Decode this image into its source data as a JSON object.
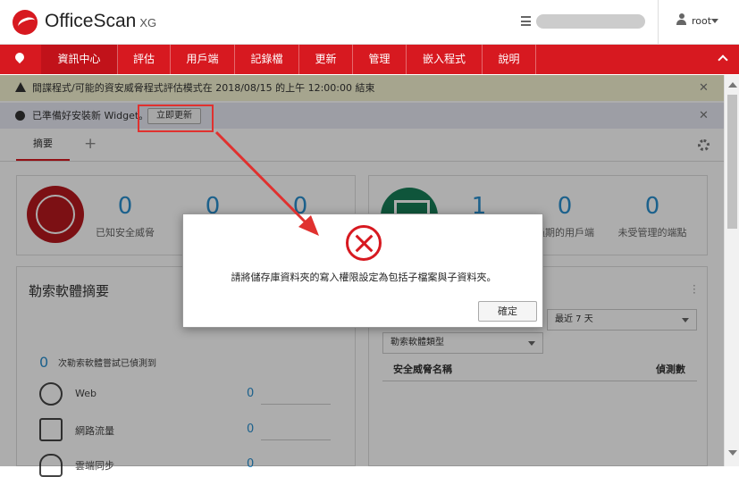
{
  "header": {
    "brand": "OfficeScan",
    "brand_suffix": "XG",
    "user": "root"
  },
  "nav": {
    "items": [
      "資訊中心",
      "評估",
      "用戶端",
      "記錄檔",
      "更新",
      "管理",
      "嵌入程式",
      "說明"
    ],
    "active_index": 0
  },
  "banners": {
    "eval_notice": "間諜程式/可能的資安威脅程式評估模式在 2018/08/15 的上午 12:00:00 結束",
    "widget_notice": "已準備好安裝新 Widget。",
    "update_now": "立即更新"
  },
  "tabs": {
    "summary": "摘要",
    "add": "+"
  },
  "left_card": {
    "stats": [
      {
        "value": "0",
        "label": "已知安全威脅"
      },
      {
        "value": "0",
        "label": ""
      },
      {
        "value": "0",
        "label": ""
      }
    ]
  },
  "right_card": {
    "stats": [
      {
        "value": "1",
        "label": ""
      },
      {
        "value": "0",
        "label": "過期的用戶端"
      },
      {
        "value": "0",
        "label": "未受管理的端點"
      }
    ]
  },
  "ransomware": {
    "title": "勒索軟體摘要",
    "count_value": "0",
    "count_label": "次勒索軟體嘗試已偵測到",
    "rows": [
      {
        "label": "Web",
        "value": "0",
        "icon": "globe-icon"
      },
      {
        "label": "網路流量",
        "value": "0",
        "icon": "network-icon"
      },
      {
        "label": "雲端同步",
        "value": "0",
        "icon": "cloud-icon"
      }
    ]
  },
  "threat_panel": {
    "period": "最近 7 天",
    "type_filter": "勒索軟體類型",
    "col_name": "安全威脅名稱",
    "col_count": "偵測數"
  },
  "dialog": {
    "message": "請將儲存庫資料夾的寫入權限設定為包括子檔案與子資料夾。",
    "ok": "確定"
  },
  "colors": {
    "brand_red": "#d71920",
    "accent_blue": "#2a8fcf",
    "callout_red": "#e0312f"
  }
}
